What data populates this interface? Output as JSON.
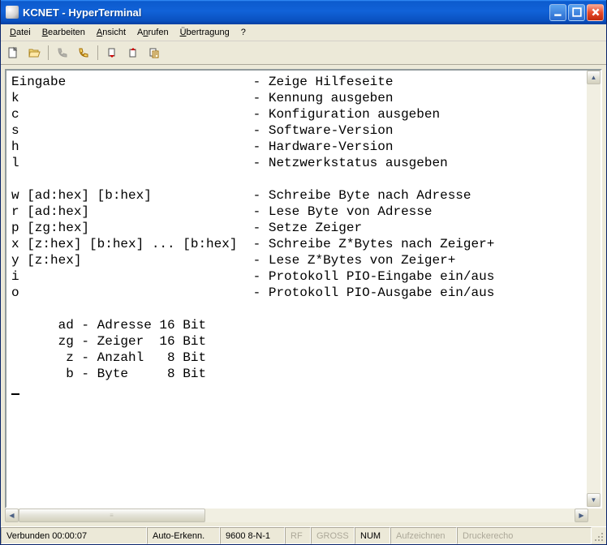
{
  "window": {
    "title": "KCNET - HyperTerminal"
  },
  "menu": {
    "datei": "Datei",
    "bearbeiten": "Bearbeiten",
    "ansicht": "Ansicht",
    "anrufen": "Anrufen",
    "uebertragung": "Übertragung",
    "hilfe": "?"
  },
  "toolbar": {
    "new": "new-file-icon",
    "open": "open-file-icon",
    "connect": "connect-icon",
    "disconnect": "disconnect-icon",
    "send": "send-icon",
    "receive": "receive-icon",
    "properties": "properties-icon"
  },
  "terminal": {
    "lines": [
      "Eingabe                        - Zeige Hilfeseite",
      "k                              - Kennung ausgeben",
      "c                              - Konfiguration ausgeben",
      "s                              - Software-Version",
      "h                              - Hardware-Version",
      "l                              - Netzwerkstatus ausgeben",
      "",
      "w [ad:hex] [b:hex]             - Schreibe Byte nach Adresse",
      "r [ad:hex]                     - Lese Byte von Adresse",
      "p [zg:hex]                     - Setze Zeiger",
      "x [z:hex] [b:hex] ... [b:hex]  - Schreibe Z*Bytes nach Zeiger+",
      "y [z:hex]                      - Lese Z*Bytes von Zeiger+",
      "i                              - Protokoll PIO-Eingabe ein/aus",
      "o                              - Protokoll PIO-Ausgabe ein/aus",
      "",
      "      ad - Adresse 16 Bit",
      "      zg - Zeiger  16 Bit",
      "       z - Anzahl   8 Bit",
      "       b - Byte     8 Bit"
    ]
  },
  "status": {
    "connected": "Verbunden 00:00:07",
    "auto": "Auto-Erkenn.",
    "params": "9600 8-N-1",
    "rf": "RF",
    "gross": "GROSS",
    "num": "NUM",
    "aufzeichnen": "Aufzeichnen",
    "druckerecho": "Druckerecho"
  }
}
